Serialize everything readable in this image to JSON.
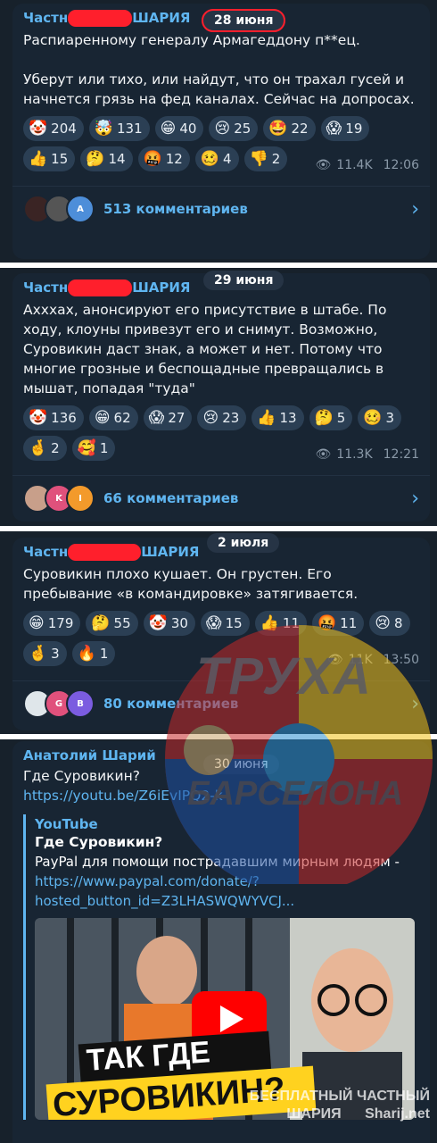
{
  "posts": [
    {
      "author": "Частн ШАРИЯ",
      "author_prefix": "Частн",
      "author_suffix": "ШАРИЯ",
      "date": "28 июня",
      "text": "Распиаренному генералу Армагеддону п**ец.\n\nУберут или тихо, или найдут, что он трахал гусей и начнется грязь на фед каналах. Сейчас на допросах.",
      "reactions": [
        {
          "emoji": "🤡",
          "count": "204"
        },
        {
          "emoji": "🤯",
          "count": "131"
        },
        {
          "emoji": "😁",
          "count": "40"
        },
        {
          "emoji": "😢",
          "count": "25"
        },
        {
          "emoji": "🤩",
          "count": "22"
        },
        {
          "emoji": "😱",
          "count": "19"
        },
        {
          "emoji": "👍",
          "count": "15"
        },
        {
          "emoji": "🤔",
          "count": "14"
        },
        {
          "emoji": "🤬",
          "count": "12"
        },
        {
          "emoji": "🥴",
          "count": "4"
        },
        {
          "emoji": "👎",
          "count": "2"
        }
      ],
      "views": "11.4K",
      "time": "12:06",
      "comments": "513 комментариев",
      "avatar_letters": [
        "",
        "",
        "A"
      ]
    },
    {
      "author": "Частн ШАРИЯ",
      "author_prefix": "Частн",
      "author_suffix": "ШАРИЯ",
      "date": "29 июня",
      "text": "Ахххах, анонсируют его присутствие в штабе. По ходу, клоуны привезут его и снимут. Возможно, Суровикин даст знак, а может и нет. Потому что многие грозные и беспощадные превращались в мышат, попадая \"туда\"",
      "reactions": [
        {
          "emoji": "🤡",
          "count": "136"
        },
        {
          "emoji": "😁",
          "count": "62"
        },
        {
          "emoji": "😱",
          "count": "27"
        },
        {
          "emoji": "😢",
          "count": "23"
        },
        {
          "emoji": "👍",
          "count": "13"
        },
        {
          "emoji": "🤔",
          "count": "5"
        },
        {
          "emoji": "🥴",
          "count": "3"
        },
        {
          "emoji": "🤞",
          "count": "2"
        },
        {
          "emoji": "🥰",
          "count": "1"
        }
      ],
      "views": "11.3K",
      "time": "12:21",
      "comments": "66 комментариев",
      "avatar_letters": [
        "",
        "K",
        "I"
      ]
    },
    {
      "author": "Частн ШАРИЯ",
      "author_prefix": "Частн",
      "author_suffix": "ШАРИЯ",
      "date": "2 июля",
      "text": "Суровикин плохо кушает. Он грустен. Его пребывание «в командировке» затягивается.",
      "reactions": [
        {
          "emoji": "😁",
          "count": "179"
        },
        {
          "emoji": "🤔",
          "count": "55"
        },
        {
          "emoji": "🤡",
          "count": "30"
        },
        {
          "emoji": "😱",
          "count": "15"
        },
        {
          "emoji": "👍",
          "count": "11"
        },
        {
          "emoji": "🤬",
          "count": "11"
        },
        {
          "emoji": "😢",
          "count": "8"
        },
        {
          "emoji": "🤞",
          "count": "3"
        },
        {
          "emoji": "🔥",
          "count": "1"
        }
      ],
      "views": "11K",
      "time": "13:50",
      "comments": "80 комментариев",
      "avatar_letters": [
        "",
        "G",
        "B"
      ]
    }
  ],
  "sharij_post": {
    "author": "Анатолий Шарий",
    "date": "30 июня",
    "text": "Где Суровикин?",
    "link": "https://youtu.be/Z6iEvIPQ2-k",
    "yt_source": "YouTube",
    "yt_title": "Где Суровикин?",
    "yt_desc": "PayPal для помощи пострадавшим мирным людям -",
    "yt_link1": "https://www.paypal.com/donate/?",
    "yt_link2": "hosted_button_id=Z3LHASWQWYVCJ...",
    "thumb_line1": "ТАК ГДЕ",
    "thumb_line2": "СУРОВИКИН?"
  },
  "watermark": {
    "word1": "ТРУХА",
    "word2": "БАРСЕЛОНА",
    "footer1": "БЕСПЛАТНЫЙ ЧАСТНЫЙ",
    "footer2": "ШАРИЯ",
    "footer_site": "Sharij.net"
  },
  "colors": {
    "accent": "#5fb5f0",
    "background": "#17212b",
    "bubble": "#182533",
    "redaction": "#ff1f2c"
  }
}
